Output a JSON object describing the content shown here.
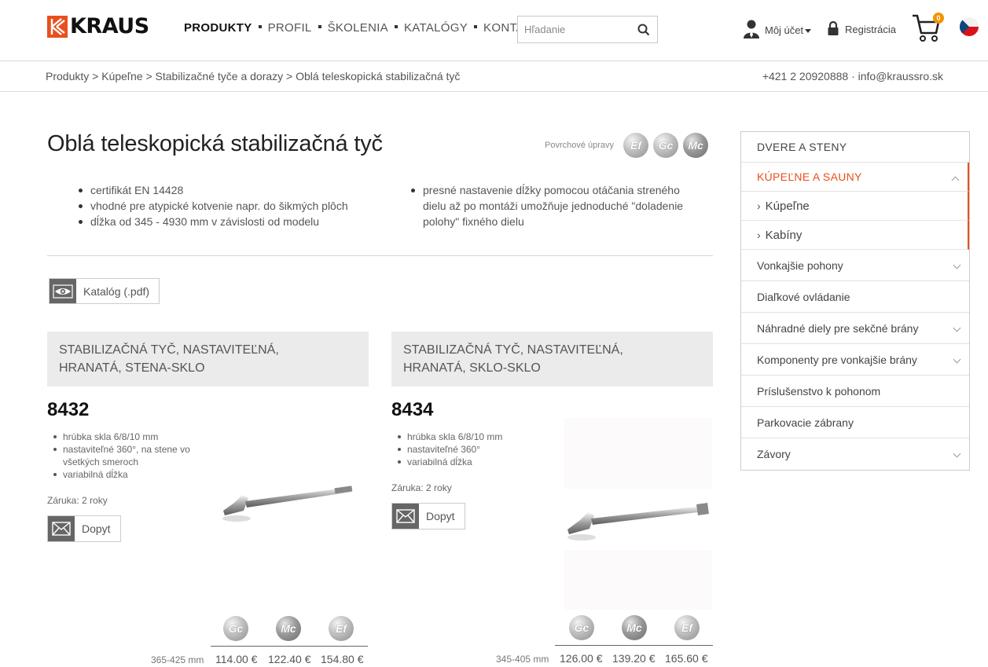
{
  "header": {
    "logo_text": "KRAUS",
    "nav": [
      {
        "label": "PRODUKTY",
        "active": true
      },
      {
        "label": "PROFIL",
        "active": false
      },
      {
        "label": "ŠKOLENIA",
        "active": false
      },
      {
        "label": "KATALÓGY",
        "active": false
      },
      {
        "label": "KONTAKTY",
        "active": false
      }
    ],
    "search_placeholder": "Hľadanie",
    "account_label": "Môj účet",
    "register_label": "Registrácia",
    "cart_count": "0",
    "brand_color": "#e8501c"
  },
  "breadcrumb": "Produkty > Kúpeľne > Stabilizačné tyče a dorazy > Oblá teleskopická stabilizačná tyč",
  "contact": "+421 2 20920888 · info@kraussro.sk",
  "page": {
    "title": "Oblá teleskopická stabilizačná tyč",
    "finishes_label": "Povrchové úpravy",
    "finishes": [
      "Ef",
      "Gc",
      "Mc"
    ],
    "features_left": [
      "certifikát EN 14428",
      "vhodné pre atypické kotvenie napr. do šikmých plôch",
      "dĺžka od 345 - 4930 mm v závislosti od modelu"
    ],
    "features_right": [
      "presné nastavenie dĺžky pomocou otáčania streného dielu až po montáži umožňuje jednoduché \"doladenie polohy\" fixného dielu"
    ],
    "catalog_label": "Katalóg (.pdf)"
  },
  "products": [
    {
      "title_line1": "STABILIZAČNÁ TYČ, NASTAVITEĽNÁ,",
      "title_line2": "HRANATÁ, STENA-SKLO",
      "code": "8432",
      "specs": [
        "hrúbka skla 6/8/10 mm",
        "nastaviteľné 360°, na stene vo všetkých smeroch",
        "variabilná dĺžka"
      ],
      "warranty": "Záruka: 2 roky",
      "inquire_label": "Dopyt",
      "finishes": [
        "Gc",
        "Mc",
        "Ef"
      ],
      "length": "365-425 mm",
      "prices": [
        "114.00 €",
        "122.40 €",
        "154.80 €"
      ]
    },
    {
      "title_line1": "STABILIZAČNÁ TYČ, NASTAVITEĽNÁ,",
      "title_line2": "HRANATÁ, SKLO-SKLO",
      "code": "8434",
      "specs": [
        "hrúbka skla 6/8/10 mm",
        "nastaviteľné 360°",
        "variabilná dĺžka"
      ],
      "warranty": "Záruka: 2 roky",
      "inquire_label": "Dopyt",
      "finishes": [
        "Gc",
        "Mc",
        "Ef"
      ],
      "length": "345-405 mm",
      "prices": [
        "126.00 €",
        "139.20 €",
        "165.60 €"
      ]
    }
  ],
  "sidebar": {
    "items": [
      {
        "label": "DVERE A STENY",
        "type": "category"
      },
      {
        "label": "KÚPEĽNE A SAUNY",
        "type": "category-active"
      },
      {
        "label": "Kúpeľne",
        "type": "sub"
      },
      {
        "label": "Kabíny",
        "type": "sub"
      },
      {
        "label": "Vonkajšie pohony",
        "type": "item",
        "chevron": true
      },
      {
        "label": "Diaľkové ovládanie",
        "type": "item",
        "chevron": false
      },
      {
        "label": "Náhradné diely pre sekčné brány",
        "type": "item",
        "chevron": true
      },
      {
        "label": "Komponenty pre vonkajšie brány",
        "type": "item",
        "chevron": true
      },
      {
        "label": "Príslušenstvo k pohonom",
        "type": "item",
        "chevron": false
      },
      {
        "label": "Parkovacie zábrany",
        "type": "item",
        "chevron": false
      },
      {
        "label": "Závory",
        "type": "item",
        "chevron": true
      }
    ]
  }
}
